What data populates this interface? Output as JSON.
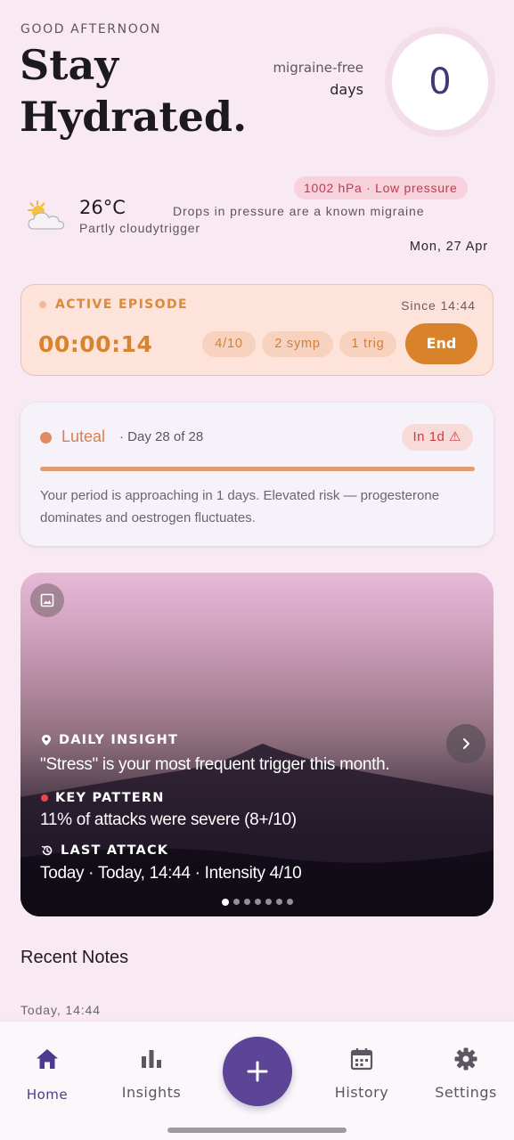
{
  "header": {
    "greeting": "GOOD AFTERNOON",
    "title_line1": "Stay",
    "title_line2": "Hydrated.",
    "migraine_free_label": "migraine-free",
    "days_label": "days",
    "migraine_free_count": "0"
  },
  "weather": {
    "icon": "partly-cloudy-icon",
    "temperature": "26°C",
    "condition": "Partly cloudy",
    "pressure_badge": "1002 hPa · Low pressure",
    "pressure_note": "Drops in pressure are a known migraine",
    "pressure_note_wrap": "trigger",
    "date": "Mon, 27 Apr"
  },
  "active_episode": {
    "label": "ACTIVE EPISODE",
    "since": "Since 14:44",
    "timer": "00:00:14",
    "intensity_chip": "4/10",
    "symptoms_chip": "2 symp",
    "triggers_chip": "1 trig",
    "end_button": "End",
    "accent_color": "#d8822a"
  },
  "cycle": {
    "phase": "Luteal",
    "day": "· Day 28 of 28",
    "badge": "In 1d ⚠",
    "progress": 1.0,
    "description": "Your period is approaching in 1 days. Elevated risk — progesterone dominates and oestrogen fluctuates."
  },
  "insight": {
    "daily_insight_label": "DAILY INSIGHT",
    "daily_insight_text": "\"Stress\" is your most frequent trigger this month.",
    "key_pattern_label": "KEY PATTERN",
    "key_pattern_text": "11% of attacks were severe (8+/10)",
    "last_attack_label": "LAST ATTACK",
    "last_attack_text": "Today  ·  Today, 14:44  ·  Intensity 4/10",
    "page_count": 7,
    "active_page": 1
  },
  "recent_notes": {
    "title": "Recent Notes",
    "first_time": "Today, 14:44"
  },
  "nav": {
    "home": "Home",
    "insights": "Insights",
    "history": "History",
    "settings": "Settings",
    "add_icon": "plus-icon"
  },
  "colors": {
    "background": "#f8e9f3",
    "primary": "#5c4496",
    "warning": "#cc3b3f"
  }
}
